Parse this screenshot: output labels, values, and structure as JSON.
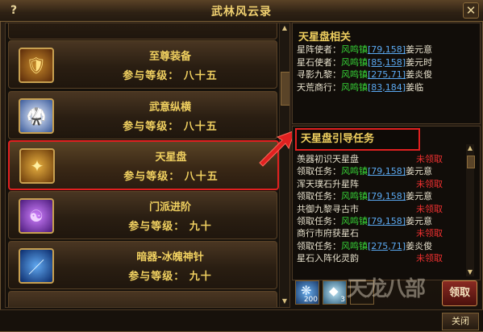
{
  "window": {
    "title": "武林风云录",
    "help_label": "?",
    "close_label": "✕"
  },
  "list": {
    "cards": [
      {
        "name": "至尊装备",
        "level": "参与等级： 八十五",
        "icon": "armor-shield-icon",
        "glyph": "🛡"
      },
      {
        "name": "武意纵横",
        "level": "参与等级： 八十五",
        "icon": "martial-figure-icon",
        "glyph": "🥋"
      },
      {
        "name": "天星盘",
        "level": "参与等级： 八十五",
        "icon": "star-disk-icon",
        "glyph": "✦"
      },
      {
        "name": "门派进阶",
        "level": "参与等级： 九十",
        "icon": "sect-advance-icon",
        "glyph": "☯"
      },
      {
        "name": "暗器-冰魄神针",
        "level": "参与等级： 九十",
        "icon": "ice-needle-icon",
        "glyph": "／"
      }
    ],
    "selected_index": 2
  },
  "info": {
    "title": "天星盘相关",
    "rows": [
      {
        "label": "星阵使者：",
        "loc": "风鸣镇",
        "coord": "[79,158]",
        "npc": "姜元意"
      },
      {
        "label": "星石使者：",
        "loc": "风鸣镇",
        "coord": "[85,158]",
        "npc": "姜元时"
      },
      {
        "label": "寻影九黎：",
        "loc": "风鸣镇",
        "coord": "[275,71]",
        "npc": "姜炎俊"
      },
      {
        "label": "天荒商行：",
        "loc": "风鸣镇",
        "coord": "[83,184]",
        "npc": "姜临"
      }
    ]
  },
  "guide": {
    "title": "天星盘引导任务",
    "rows": [
      {
        "text": "羡器初识天星盘",
        "status": "未领取"
      },
      {
        "prefix": "领取任务：",
        "loc": "风鸣镇",
        "coord": "[79,158]",
        "npc": "姜元意"
      },
      {
        "text": "浑天璞石升星阵",
        "status": "未领取"
      },
      {
        "prefix": "领取任务：",
        "loc": "风鸣镇",
        "coord": "[79,158]",
        "npc": "姜元意"
      },
      {
        "text": "共御九黎寻古市",
        "status": "未领取"
      },
      {
        "prefix": "领取任务：",
        "loc": "风鸣镇",
        "coord": "[79,158]",
        "npc": "姜元意"
      },
      {
        "text": "商行市府获星石",
        "status": "未领取"
      },
      {
        "prefix": "领取任务：",
        "loc": "风鸣镇",
        "coord": "[275,71]",
        "npc": "姜炎俊"
      },
      {
        "text": "星石入阵化灵韵",
        "status": "未领取"
      }
    ]
  },
  "rewards": {
    "slots": [
      {
        "icon": "feather-item-icon",
        "glyph": "❋",
        "count": "200",
        "color": "#3a8ad0"
      },
      {
        "icon": "crystal-item-icon",
        "glyph": "◆",
        "count": "3",
        "color": "#a0d8f0"
      },
      {
        "icon": "empty-slot-icon",
        "glyph": "",
        "count": "",
        "color": "#2a2018"
      }
    ],
    "claim_label": "领取"
  },
  "watermark": "天龙八部",
  "footer": {
    "close_label": "关闭"
  },
  "colors": {
    "accent_gold": "#f0d060",
    "location_green": "#38d838",
    "coord_blue": "#5aa8f0",
    "status_red": "#f03030",
    "highlight_red": "#e02020"
  }
}
